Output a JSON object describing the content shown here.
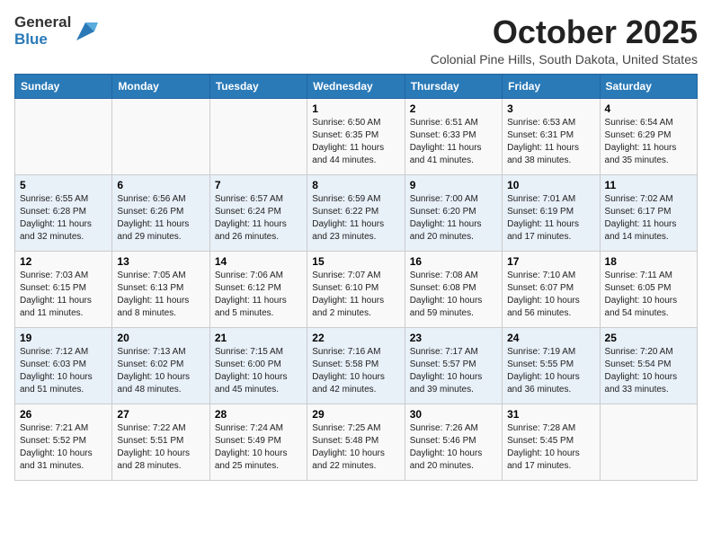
{
  "logo": {
    "general": "General",
    "blue": "Blue"
  },
  "title": "October 2025",
  "subtitle": "Colonial Pine Hills, South Dakota, United States",
  "weekdays": [
    "Sunday",
    "Monday",
    "Tuesday",
    "Wednesday",
    "Thursday",
    "Friday",
    "Saturday"
  ],
  "weeks": [
    [
      {
        "day": "",
        "info": ""
      },
      {
        "day": "",
        "info": ""
      },
      {
        "day": "",
        "info": ""
      },
      {
        "day": "1",
        "info": "Sunrise: 6:50 AM\nSunset: 6:35 PM\nDaylight: 11 hours\nand 44 minutes."
      },
      {
        "day": "2",
        "info": "Sunrise: 6:51 AM\nSunset: 6:33 PM\nDaylight: 11 hours\nand 41 minutes."
      },
      {
        "day": "3",
        "info": "Sunrise: 6:53 AM\nSunset: 6:31 PM\nDaylight: 11 hours\nand 38 minutes."
      },
      {
        "day": "4",
        "info": "Sunrise: 6:54 AM\nSunset: 6:29 PM\nDaylight: 11 hours\nand 35 minutes."
      }
    ],
    [
      {
        "day": "5",
        "info": "Sunrise: 6:55 AM\nSunset: 6:28 PM\nDaylight: 11 hours\nand 32 minutes."
      },
      {
        "day": "6",
        "info": "Sunrise: 6:56 AM\nSunset: 6:26 PM\nDaylight: 11 hours\nand 29 minutes."
      },
      {
        "day": "7",
        "info": "Sunrise: 6:57 AM\nSunset: 6:24 PM\nDaylight: 11 hours\nand 26 minutes."
      },
      {
        "day": "8",
        "info": "Sunrise: 6:59 AM\nSunset: 6:22 PM\nDaylight: 11 hours\nand 23 minutes."
      },
      {
        "day": "9",
        "info": "Sunrise: 7:00 AM\nSunset: 6:20 PM\nDaylight: 11 hours\nand 20 minutes."
      },
      {
        "day": "10",
        "info": "Sunrise: 7:01 AM\nSunset: 6:19 PM\nDaylight: 11 hours\nand 17 minutes."
      },
      {
        "day": "11",
        "info": "Sunrise: 7:02 AM\nSunset: 6:17 PM\nDaylight: 11 hours\nand 14 minutes."
      }
    ],
    [
      {
        "day": "12",
        "info": "Sunrise: 7:03 AM\nSunset: 6:15 PM\nDaylight: 11 hours\nand 11 minutes."
      },
      {
        "day": "13",
        "info": "Sunrise: 7:05 AM\nSunset: 6:13 PM\nDaylight: 11 hours\nand 8 minutes."
      },
      {
        "day": "14",
        "info": "Sunrise: 7:06 AM\nSunset: 6:12 PM\nDaylight: 11 hours\nand 5 minutes."
      },
      {
        "day": "15",
        "info": "Sunrise: 7:07 AM\nSunset: 6:10 PM\nDaylight: 11 hours\nand 2 minutes."
      },
      {
        "day": "16",
        "info": "Sunrise: 7:08 AM\nSunset: 6:08 PM\nDaylight: 10 hours\nand 59 minutes."
      },
      {
        "day": "17",
        "info": "Sunrise: 7:10 AM\nSunset: 6:07 PM\nDaylight: 10 hours\nand 56 minutes."
      },
      {
        "day": "18",
        "info": "Sunrise: 7:11 AM\nSunset: 6:05 PM\nDaylight: 10 hours\nand 54 minutes."
      }
    ],
    [
      {
        "day": "19",
        "info": "Sunrise: 7:12 AM\nSunset: 6:03 PM\nDaylight: 10 hours\nand 51 minutes."
      },
      {
        "day": "20",
        "info": "Sunrise: 7:13 AM\nSunset: 6:02 PM\nDaylight: 10 hours\nand 48 minutes."
      },
      {
        "day": "21",
        "info": "Sunrise: 7:15 AM\nSunset: 6:00 PM\nDaylight: 10 hours\nand 45 minutes."
      },
      {
        "day": "22",
        "info": "Sunrise: 7:16 AM\nSunset: 5:58 PM\nDaylight: 10 hours\nand 42 minutes."
      },
      {
        "day": "23",
        "info": "Sunrise: 7:17 AM\nSunset: 5:57 PM\nDaylight: 10 hours\nand 39 minutes."
      },
      {
        "day": "24",
        "info": "Sunrise: 7:19 AM\nSunset: 5:55 PM\nDaylight: 10 hours\nand 36 minutes."
      },
      {
        "day": "25",
        "info": "Sunrise: 7:20 AM\nSunset: 5:54 PM\nDaylight: 10 hours\nand 33 minutes."
      }
    ],
    [
      {
        "day": "26",
        "info": "Sunrise: 7:21 AM\nSunset: 5:52 PM\nDaylight: 10 hours\nand 31 minutes."
      },
      {
        "day": "27",
        "info": "Sunrise: 7:22 AM\nSunset: 5:51 PM\nDaylight: 10 hours\nand 28 minutes."
      },
      {
        "day": "28",
        "info": "Sunrise: 7:24 AM\nSunset: 5:49 PM\nDaylight: 10 hours\nand 25 minutes."
      },
      {
        "day": "29",
        "info": "Sunrise: 7:25 AM\nSunset: 5:48 PM\nDaylight: 10 hours\nand 22 minutes."
      },
      {
        "day": "30",
        "info": "Sunrise: 7:26 AM\nSunset: 5:46 PM\nDaylight: 10 hours\nand 20 minutes."
      },
      {
        "day": "31",
        "info": "Sunrise: 7:28 AM\nSunset: 5:45 PM\nDaylight: 10 hours\nand 17 minutes."
      },
      {
        "day": "",
        "info": ""
      }
    ]
  ]
}
